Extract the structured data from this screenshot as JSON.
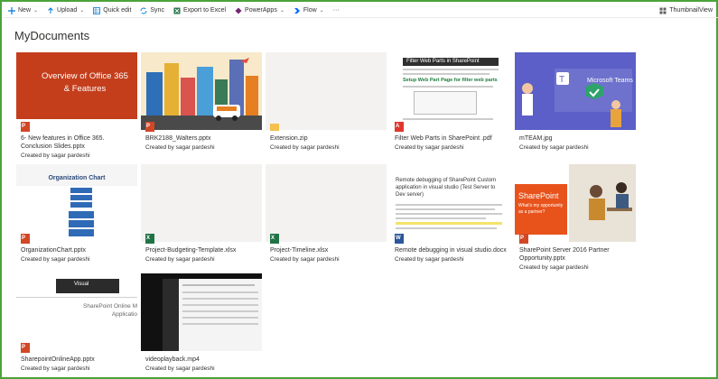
{
  "toolbar": {
    "new": "New",
    "upload": "Upload",
    "quick_edit": "Quick edit",
    "sync": "Sync",
    "export": "Export to Excel",
    "powerapps": "PowerApps",
    "flow": "Flow",
    "more": "···",
    "view": "ThumbnailView"
  },
  "page_title": "MyDocuments",
  "tiles": [
    {
      "name": "6- New features in Office 365. Conclusion Slides.pptx",
      "by": "Created by sagar pardeshi",
      "thumb_title": "Overview of Office 365 & Features"
    },
    {
      "name": "BRK2188_Walters.pptx",
      "by": "Created by sagar pardeshi"
    },
    {
      "name": "Extension.zip",
      "by": "Created by sagar pardeshi"
    },
    {
      "name": "Filter Web Parts in SharePoint .pdf",
      "by": "Created by sagar pardeshi",
      "thumb_title": "Filter Web Parts in SharePoint",
      "thumb_sub": "Setup Web Part Page for filter web parts"
    },
    {
      "name": "mTEAM.jpg",
      "by": "Created by sagar pardeshi",
      "thumb_title": "Microsoft Teams"
    },
    {
      "name": "OrganizationChart.pptx",
      "by": "Created by sagar pardeshi",
      "thumb_title": "Organization Chart"
    },
    {
      "name": "Project-Budgeting-Template.xlsx",
      "by": "Created by sagar pardeshi"
    },
    {
      "name": "Project-Timeline.xlsx",
      "by": "Created by sagar pardeshi"
    },
    {
      "name": "Remote debugging in visual studio.docx",
      "by": "Created by sagar pardeshi",
      "thumb_title": "Remote debugging of SharePoint Custom application in visual studio (Test Server to Dev server)"
    },
    {
      "name": "SharePoint Server 2016 Partner Opportunity.pptx",
      "by": "Created by sagar pardeshi",
      "thumb_title": "SharePoint",
      "thumb_sub": "What's my opportunity as a partner?"
    },
    {
      "name": "SharepointOnlineApp.pptx",
      "by": "Created by sagar pardeshi",
      "thumb_title": "SharePoint Online M Applicatio"
    },
    {
      "name": "videoplayback.mp4",
      "by": "Created by sagar pardeshi"
    }
  ]
}
